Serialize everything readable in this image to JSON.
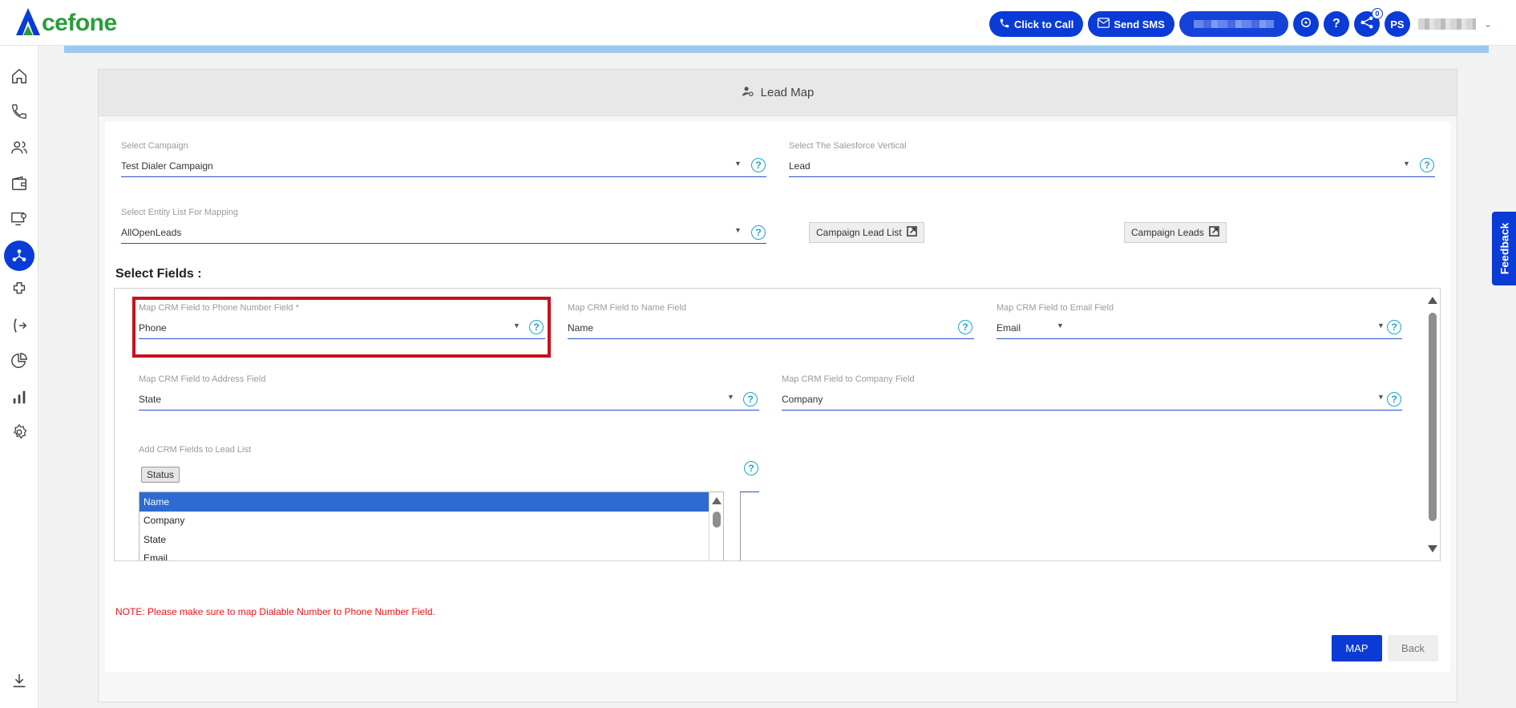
{
  "brand": {
    "logo_text": "cefone",
    "accent_green": "#2a9d3a",
    "accent_blue": "#0a3bd6"
  },
  "header": {
    "click_to_call": "Click to Call",
    "send_sms": "Send SMS",
    "help_glyph": "?",
    "notif_count": "0",
    "avatar_initials": "PS"
  },
  "sidebar": {
    "items": [
      "home-icon",
      "phone-icon",
      "contacts-icon",
      "wallet-icon",
      "monitor-settings-icon",
      "crm-integration-icon",
      "plugins-icon",
      "call-forward-icon",
      "pie-chart-icon",
      "bar-chart-icon",
      "settings-icon",
      "download-icon"
    ],
    "active": "crm-integration-icon"
  },
  "page": {
    "title": "Lead Map",
    "campaign": {
      "label": "Select Campaign",
      "value": "Test Dialer Campaign"
    },
    "vertical": {
      "label": "Select The Salesforce Vertical",
      "value": "Lead"
    },
    "entity_list": {
      "label": "Select Entity List For Mapping",
      "value": "AllOpenLeads"
    },
    "campaign_lead_list_btn": "Campaign Lead List",
    "campaign_leads_btn": "Campaign Leads",
    "select_fields_heading": "Select Fields :",
    "map_phone": {
      "label": "Map CRM Field to Phone Number Field *",
      "value": "Phone"
    },
    "map_name": {
      "label": "Map CRM Field to Name Field",
      "value": "Name"
    },
    "map_email": {
      "label": "Map CRM Field to Email Field",
      "value": "Email"
    },
    "map_address": {
      "label": "Map CRM Field to Address Field",
      "value": "State"
    },
    "map_company": {
      "label": "Map CRM Field to Company Field",
      "value": "Company"
    },
    "add_fields": {
      "label": "Add CRM Fields to Lead List",
      "chip": "Status",
      "options": [
        "Name",
        "Company",
        "State",
        "Email"
      ],
      "selected": "Name"
    },
    "note": "NOTE: Please make sure to map Dialable Number to Phone Number Field.",
    "map_btn": "MAP",
    "back_btn": "Back"
  },
  "feedback_tab": "Feedback"
}
